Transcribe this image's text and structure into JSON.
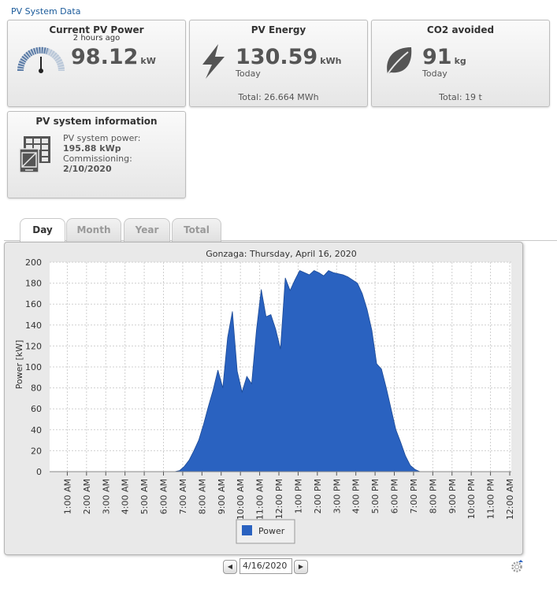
{
  "page": {
    "title": "PV System Data"
  },
  "cards": {
    "current_power": {
      "title": "Current PV Power",
      "subtitle": "2 hours ago",
      "value": "98.12",
      "unit": "kW"
    },
    "energy": {
      "title": "PV Energy",
      "value": "130.59",
      "unit": "kWh",
      "period": "Today",
      "total": "Total: 26.664 MWh"
    },
    "co2": {
      "title": "CO2 avoided",
      "value": "91",
      "unit": "kg",
      "period": "Today",
      "total": "Total: 19 t"
    },
    "info": {
      "title": "PV system information",
      "power_label": "PV system power:",
      "power_value": "195.88 kWp",
      "commission_label": "Commissioning:",
      "commission_value": "2/10/2020"
    }
  },
  "tabs": [
    {
      "label": "Day",
      "active": true
    },
    {
      "label": "Month",
      "active": false
    },
    {
      "label": "Year",
      "active": false
    },
    {
      "label": "Total",
      "active": false
    }
  ],
  "date_nav": {
    "date": "4/16/2020",
    "prev_icon": "chevron-left-icon",
    "next_icon": "chevron-right-icon",
    "settings_icon": "gear-icon"
  },
  "chart_data": {
    "type": "area",
    "title": "Gonzaga: Thursday, April 16, 2020",
    "ylabel": "Power [kW]",
    "xlabel": "",
    "ylim": [
      0,
      200
    ],
    "yticks": [
      0,
      20,
      40,
      60,
      80,
      100,
      120,
      140,
      160,
      180,
      200
    ],
    "xticks": [
      "1:00 AM",
      "2:00 AM",
      "3:00 AM",
      "4:00 AM",
      "5:00 AM",
      "6:00 AM",
      "7:00 AM",
      "8:00 AM",
      "9:00 AM",
      "10:00 AM",
      "11:00 AM",
      "12:00 PM",
      "1:00 PM",
      "2:00 PM",
      "3:00 PM",
      "4:00 PM",
      "5:00 PM",
      "6:00 PM",
      "7:00 PM",
      "8:00 PM",
      "9:00 PM",
      "10:00 PM",
      "11:00 PM",
      "12:00 AM"
    ],
    "grid": true,
    "legend_position": "bottom",
    "color": "#2a62c0",
    "series": [
      {
        "name": "Power",
        "x_hours": [
          0,
          6.5,
          6.75,
          7.0,
          7.25,
          7.5,
          7.75,
          8.0,
          8.25,
          8.5,
          8.75,
          9.0,
          9.25,
          9.5,
          9.75,
          10.0,
          10.25,
          10.5,
          10.75,
          11.0,
          11.25,
          11.5,
          11.75,
          12.0,
          12.25,
          12.5,
          12.75,
          13.0,
          13.25,
          13.5,
          13.75,
          14.0,
          14.25,
          14.5,
          14.75,
          15.0,
          15.25,
          15.5,
          15.75,
          16.0,
          16.25,
          16.5,
          16.75,
          17.0,
          17.25,
          17.5,
          17.75,
          18.0,
          18.25,
          18.5,
          18.75,
          19.0,
          19.25,
          19.5,
          19.75,
          20.0,
          20.25,
          24
        ],
        "values": [
          0,
          0,
          1,
          5,
          11,
          20,
          30,
          45,
          62,
          78,
          97,
          80,
          128,
          153,
          96,
          76,
          91,
          84,
          135,
          174,
          148,
          150,
          136,
          117,
          185,
          173,
          183,
          192,
          190,
          188,
          192,
          190,
          187,
          192,
          190,
          189,
          188,
          186,
          183,
          180,
          170,
          155,
          135,
          103,
          98,
          80,
          60,
          40,
          28,
          15,
          6,
          2,
          0,
          0,
          0,
          0,
          0,
          0
        ]
      }
    ]
  }
}
